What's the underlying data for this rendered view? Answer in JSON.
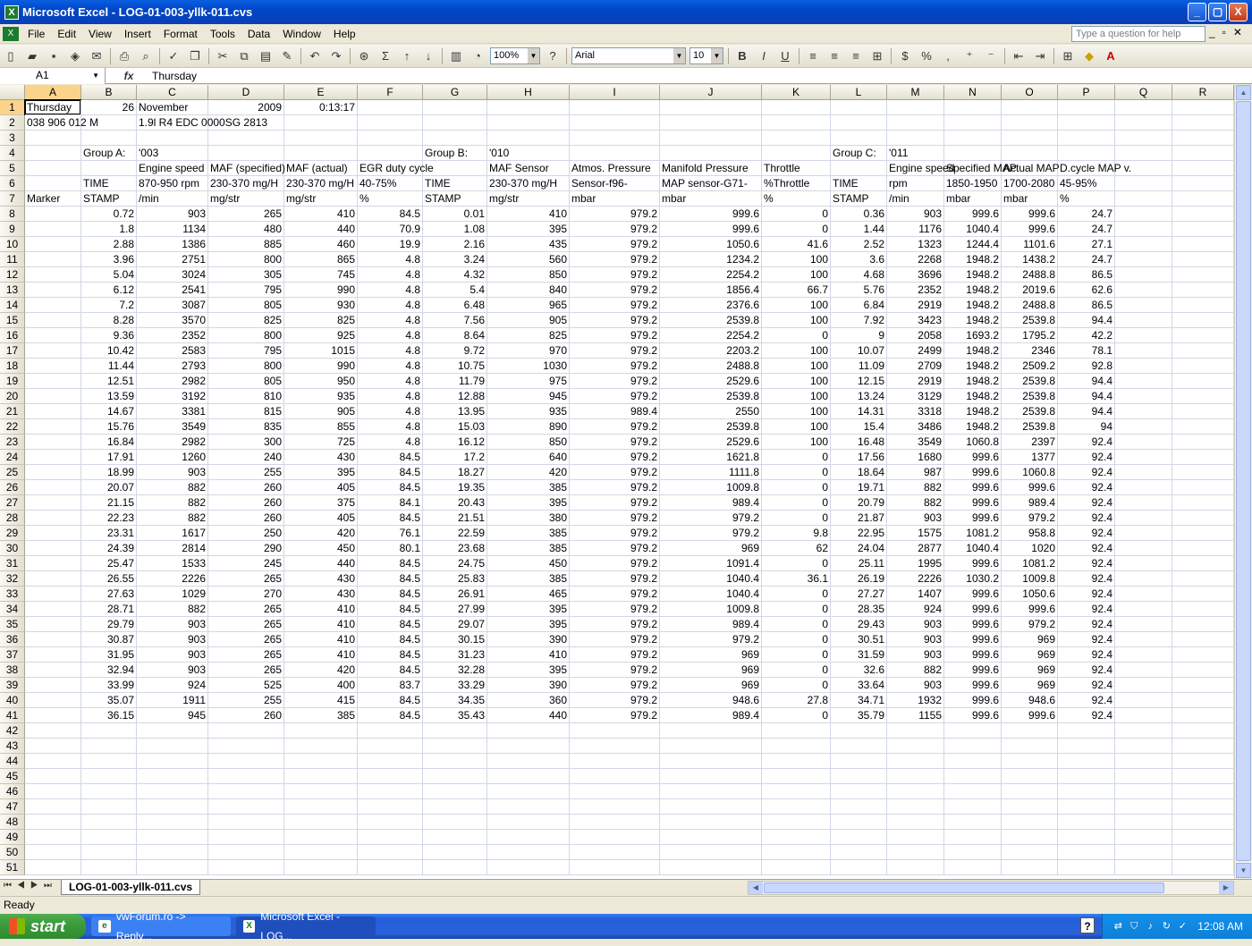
{
  "window": {
    "title": "Microsoft Excel - LOG-01-003-yllk-011.cvs",
    "min": "_",
    "max": "▢",
    "close": "X"
  },
  "menu": {
    "items": [
      "File",
      "Edit",
      "View",
      "Insert",
      "Format",
      "Tools",
      "Data",
      "Window",
      "Help"
    ],
    "help_placeholder": "Type a question for help"
  },
  "toolbar": {
    "zoom": "100%",
    "font": "Arial",
    "font_size": "10"
  },
  "formula": {
    "cell_ref": "A1",
    "fx": "fx",
    "value": "Thursday"
  },
  "columns": [
    "A",
    "B",
    "C",
    "D",
    "E",
    "F",
    "G",
    "H",
    "I",
    "J",
    "K",
    "L",
    "M",
    "N",
    "O",
    "P",
    "Q",
    "R"
  ],
  "rows": {
    "1": [
      "Thursday",
      "26",
      "November",
      "2009",
      "0:13:17"
    ],
    "2": [
      "038 906 012 M",
      "",
      "1.9l R4 EDC 0000SG  2813"
    ],
    "4": [
      "",
      "Group A:",
      "'003",
      "",
      "",
      "",
      "Group B:",
      "'010",
      "",
      "",
      "",
      "Group C:",
      "'011"
    ],
    "5": [
      "",
      "",
      "Engine speed",
      "MAF (specified)",
      "MAF (actual)",
      "EGR duty cycle",
      "",
      "MAF Sensor",
      "Atmos. Pressure",
      "Manifold Pressure",
      "Throttle",
      "",
      "Engine speed",
      "Specified MAP",
      "Actual MAP",
      "D.cycle MAP v."
    ],
    "6": [
      "",
      "TIME",
      "870-950 rpm",
      "230-370 mg/H",
      "230-370 mg/H",
      "40-75%",
      "TIME",
      "230-370 mg/H",
      "Sensor-f96-",
      "MAP sensor-G71-",
      "%Throttle",
      "TIME",
      "rpm",
      "1850-1950",
      "1700-2080",
      "45-95%"
    ],
    "7": [
      "Marker",
      "STAMP",
      "/min",
      "mg/str",
      "mg/str",
      "%",
      "STAMP",
      "mg/str",
      "mbar",
      "mbar",
      "%",
      "STAMP",
      "/min",
      "mbar",
      "mbar",
      "%"
    ]
  },
  "data": [
    [
      0.72,
      903,
      265,
      410,
      84.5,
      0.01,
      410,
      979.2,
      999.6,
      0,
      0.36,
      903,
      999.6,
      999.6,
      24.7
    ],
    [
      1.8,
      1134,
      480,
      440,
      70.9,
      1.08,
      395,
      979.2,
      999.6,
      0,
      1.44,
      1176,
      1040.4,
      999.6,
      24.7
    ],
    [
      2.88,
      1386,
      885,
      460,
      19.9,
      2.16,
      435,
      979.2,
      1050.6,
      41.6,
      2.52,
      1323,
      1244.4,
      1101.6,
      27.1
    ],
    [
      3.96,
      2751,
      800,
      865,
      4.8,
      3.24,
      560,
      979.2,
      1234.2,
      100,
      3.6,
      2268,
      1948.2,
      1438.2,
      24.7
    ],
    [
      5.04,
      3024,
      305,
      745,
      4.8,
      4.32,
      850,
      979.2,
      2254.2,
      100,
      4.68,
      3696,
      1948.2,
      2488.8,
      86.5
    ],
    [
      6.12,
      2541,
      795,
      990,
      4.8,
      5.4,
      840,
      979.2,
      1856.4,
      66.7,
      5.76,
      2352,
      1948.2,
      2019.6,
      62.6
    ],
    [
      7.2,
      3087,
      805,
      930,
      4.8,
      6.48,
      965,
      979.2,
      2376.6,
      100,
      6.84,
      2919,
      1948.2,
      2488.8,
      86.5
    ],
    [
      8.28,
      3570,
      825,
      825,
      4.8,
      7.56,
      905,
      979.2,
      2539.8,
      100,
      7.92,
      3423,
      1948.2,
      2539.8,
      94.4
    ],
    [
      9.36,
      2352,
      800,
      925,
      4.8,
      8.64,
      825,
      979.2,
      2254.2,
      0,
      9,
      2058,
      1693.2,
      1795.2,
      42.2
    ],
    [
      10.42,
      2583,
      795,
      1015,
      4.8,
      9.72,
      970,
      979.2,
      2203.2,
      100,
      10.07,
      2499,
      1948.2,
      2346,
      78.1
    ],
    [
      11.44,
      2793,
      800,
      990,
      4.8,
      10.75,
      1030,
      979.2,
      2488.8,
      100,
      11.09,
      2709,
      1948.2,
      2509.2,
      92.8
    ],
    [
      12.51,
      2982,
      805,
      950,
      4.8,
      11.79,
      975,
      979.2,
      2529.6,
      100,
      12.15,
      2919,
      1948.2,
      2539.8,
      94.4
    ],
    [
      13.59,
      3192,
      810,
      935,
      4.8,
      12.88,
      945,
      979.2,
      2539.8,
      100,
      13.24,
      3129,
      1948.2,
      2539.8,
      94.4
    ],
    [
      14.67,
      3381,
      815,
      905,
      4.8,
      13.95,
      935,
      989.4,
      2550,
      100,
      14.31,
      3318,
      1948.2,
      2539.8,
      94.4
    ],
    [
      15.76,
      3549,
      835,
      855,
      4.8,
      15.03,
      890,
      979.2,
      2539.8,
      100,
      15.4,
      3486,
      1948.2,
      2539.8,
      94
    ],
    [
      16.84,
      2982,
      300,
      725,
      4.8,
      16.12,
      850,
      979.2,
      2529.6,
      100,
      16.48,
      3549,
      1060.8,
      2397,
      92.4
    ],
    [
      17.91,
      1260,
      240,
      430,
      84.5,
      17.2,
      640,
      979.2,
      1621.8,
      0,
      17.56,
      1680,
      999.6,
      1377,
      92.4
    ],
    [
      18.99,
      903,
      255,
      395,
      84.5,
      18.27,
      420,
      979.2,
      1111.8,
      0,
      18.64,
      987,
      999.6,
      1060.8,
      92.4
    ],
    [
      20.07,
      882,
      260,
      405,
      84.5,
      19.35,
      385,
      979.2,
      1009.8,
      0,
      19.71,
      882,
      999.6,
      999.6,
      92.4
    ],
    [
      21.15,
      882,
      260,
      375,
      84.1,
      20.43,
      395,
      979.2,
      989.4,
      0,
      20.79,
      882,
      999.6,
      989.4,
      92.4
    ],
    [
      22.23,
      882,
      260,
      405,
      84.5,
      21.51,
      380,
      979.2,
      979.2,
      0,
      21.87,
      903,
      999.6,
      979.2,
      92.4
    ],
    [
      23.31,
      1617,
      250,
      420,
      76.1,
      22.59,
      385,
      979.2,
      979.2,
      9.8,
      22.95,
      1575,
      1081.2,
      958.8,
      92.4
    ],
    [
      24.39,
      2814,
      290,
      450,
      80.1,
      23.68,
      385,
      979.2,
      969,
      62,
      24.04,
      2877,
      1040.4,
      1020,
      92.4
    ],
    [
      25.47,
      1533,
      245,
      440,
      84.5,
      24.75,
      450,
      979.2,
      1091.4,
      0,
      25.11,
      1995,
      999.6,
      1081.2,
      92.4
    ],
    [
      26.55,
      2226,
      265,
      430,
      84.5,
      25.83,
      385,
      979.2,
      1040.4,
      36.1,
      26.19,
      2226,
      1030.2,
      1009.8,
      92.4
    ],
    [
      27.63,
      1029,
      270,
      430,
      84.5,
      26.91,
      465,
      979.2,
      1040.4,
      0,
      27.27,
      1407,
      999.6,
      1050.6,
      92.4
    ],
    [
      28.71,
      882,
      265,
      410,
      84.5,
      27.99,
      395,
      979.2,
      1009.8,
      0,
      28.35,
      924,
      999.6,
      999.6,
      92.4
    ],
    [
      29.79,
      903,
      265,
      410,
      84.5,
      29.07,
      395,
      979.2,
      989.4,
      0,
      29.43,
      903,
      999.6,
      979.2,
      92.4
    ],
    [
      30.87,
      903,
      265,
      410,
      84.5,
      30.15,
      390,
      979.2,
      979.2,
      0,
      30.51,
      903,
      999.6,
      969,
      92.4
    ],
    [
      31.95,
      903,
      265,
      410,
      84.5,
      31.23,
      410,
      979.2,
      969,
      0,
      31.59,
      903,
      999.6,
      969,
      92.4
    ],
    [
      32.94,
      903,
      265,
      420,
      84.5,
      32.28,
      395,
      979.2,
      969,
      0,
      32.6,
      882,
      999.6,
      969,
      92.4
    ],
    [
      33.99,
      924,
      525,
      400,
      83.7,
      33.29,
      390,
      979.2,
      969,
      0,
      33.64,
      903,
      999.6,
      969,
      92.4
    ],
    [
      35.07,
      1911,
      255,
      415,
      84.5,
      34.35,
      360,
      979.2,
      948.6,
      27.8,
      34.71,
      1932,
      999.6,
      948.6,
      92.4
    ],
    [
      36.15,
      945,
      260,
      385,
      84.5,
      35.43,
      440,
      979.2,
      989.4,
      0,
      35.79,
      1155,
      999.6,
      999.6,
      92.4
    ]
  ],
  "sheet": {
    "tab": "LOG-01-003-yllk-011.cvs"
  },
  "status": {
    "text": "Ready"
  },
  "taskbar": {
    "start": "start",
    "tasks": [
      "vwForum.ro -> Reply...",
      "Microsoft Excel - LOG..."
    ],
    "clock": "12:08 AM"
  }
}
